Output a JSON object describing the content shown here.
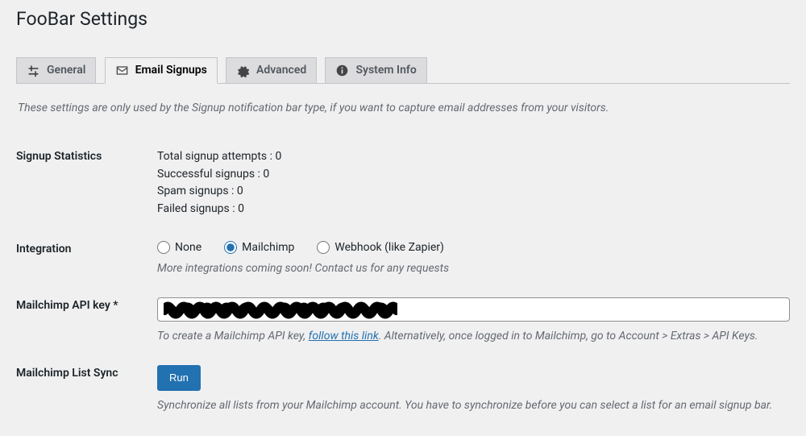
{
  "page_title": "FooBar Settings",
  "tabs": [
    {
      "label": "General",
      "icon": "sliders"
    },
    {
      "label": "Email Signups",
      "icon": "envelope"
    },
    {
      "label": "Advanced",
      "icon": "gear"
    },
    {
      "label": "System Info",
      "icon": "info"
    }
  ],
  "active_tab_index": 1,
  "intro_text": "These settings are only used by the Signup notification bar type, if you want to capture email addresses from your visitors.",
  "sections": {
    "stats": {
      "label": "Signup Statistics",
      "lines": {
        "total": "Total signup attempts : 0",
        "success": "Successful signups : 0",
        "spam": "Spam signups : 0",
        "failed": "Failed signups : 0"
      }
    },
    "integration": {
      "label": "Integration",
      "options": {
        "none": "None",
        "mailchimp": "Mailchimp",
        "webhook": "Webhook (like Zapier)"
      },
      "selected": "mailchimp",
      "note": "More integrations coming soon! Contact us for any requests"
    },
    "api_key": {
      "label": "Mailchimp API key *",
      "value": "",
      "desc_prefix": "To create a Mailchimp API key, ",
      "desc_link": "follow this link",
      "desc_suffix": ". Alternatively, once logged in to Mailchimp, go to Account > Extras > API Keys."
    },
    "sync": {
      "label": "Mailchimp List Sync",
      "button": "Run",
      "desc": "Synchronize all lists from your Mailchimp account. You have to synchronize before you can select a list for an email signup bar."
    }
  }
}
